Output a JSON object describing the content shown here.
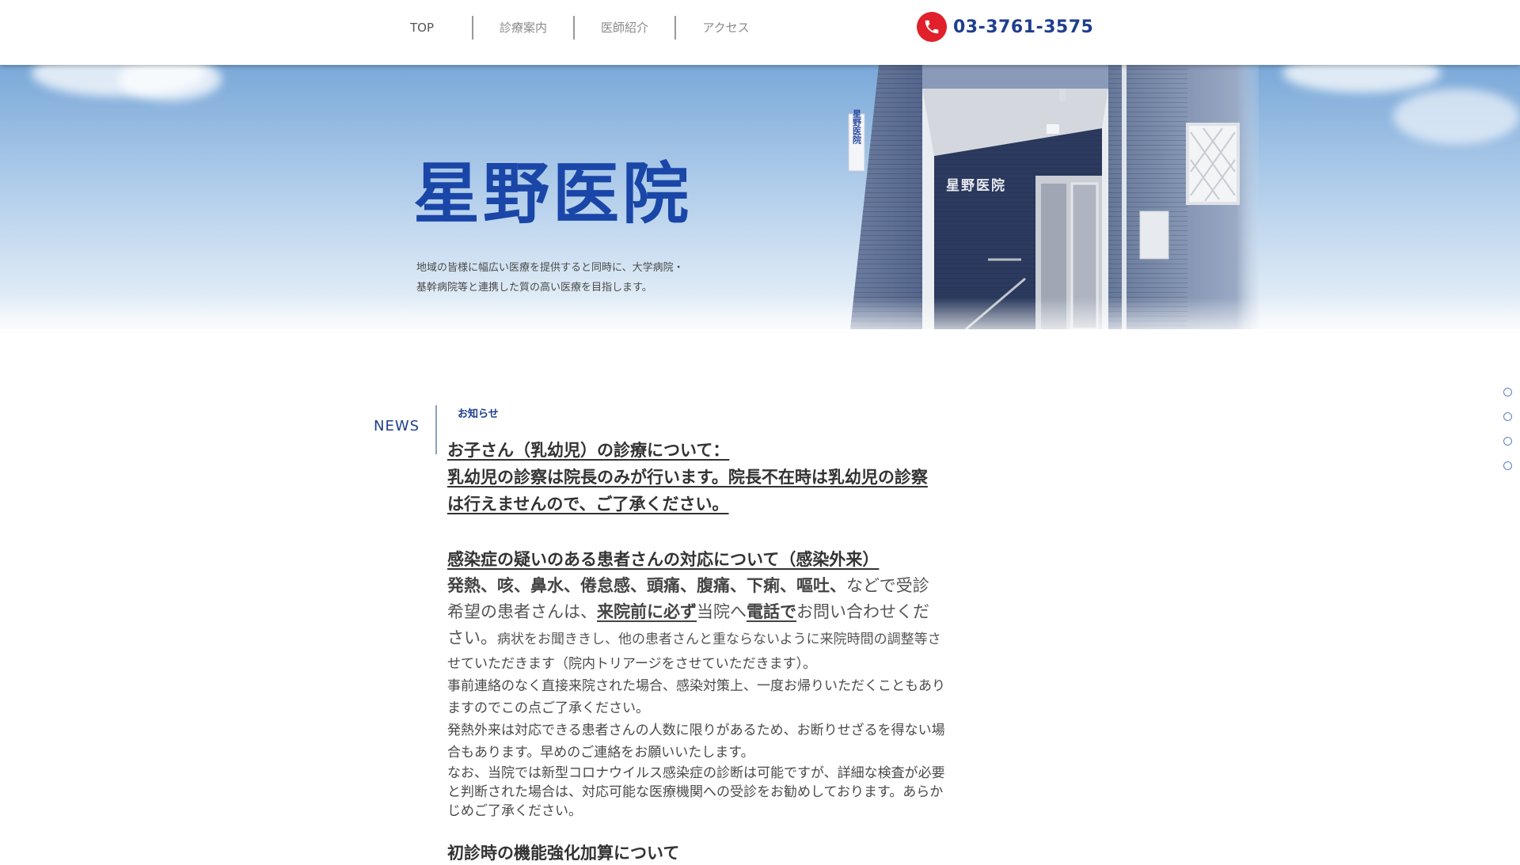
{
  "header": {
    "nav": [
      "TOP",
      "診療案内",
      "医師紹介",
      "アクセス"
    ],
    "phone": "03-3761-3575",
    "phone_icon": "phone-icon"
  },
  "hero": {
    "clinic_name": "星野医院",
    "tagline_line1": "地域の皆様に幅広い医療を提供すると同時に、大学病院・",
    "tagline_line2": "基幹病院等と連携した質の高い医療を目指します。",
    "sign_text": "星野医院",
    "sign_vertical": "星野医院"
  },
  "news": {
    "label": "NEWS",
    "category": "お知らせ",
    "block1": {
      "line1": "お子さん（乳幼児）の診療について：",
      "line2": "乳幼児の診察は院長のみが行います。院長不在時は乳幼児の診察",
      "line3": "は行えませんので、ご了承ください。"
    },
    "block2": {
      "title": "感染症の疑いのある患者さんの対応について（感染外来）",
      "symptoms": "発熱、咳、鼻水、倦怠感、頭痛、腹痛、下痢、嘔吐、",
      "text1": "などで受診",
      "text2": "希望の患者さんは、",
      "emph1": "来院前に必ず",
      "text3": "当院へ",
      "emph2": "電話で",
      "text4": "お問い合わせくだ",
      "text5": "さい。",
      "text6": "病状をお聞ききし、他の患者さんと重ならないように来院時間の調整等さ",
      "para1": "せていただきます（院内トリアージをさせていただきます）。",
      "para2": "事前連絡のなく直接来院された場合、感染対策上、一度お帰りいただくこともあり",
      "para3": "ますのでこの点ご了承ください。",
      "para4": "発熱外来は対応できる患者さんの人数に限りがあるため、お断りせざるを得ない場",
      "para5": "合もあります。早めのご連絡をお願いいたします。",
      "para6": "なお、当院では新型コロナウイルス感染症の診断は可能ですが、詳細な検査が必要",
      "para7": "と判断された場合は、対応可能な医療機関への受診をお勧めしております。あらか",
      "para8": "じめご了承ください。"
    },
    "block3_title": "初診時の機能強化加算について"
  },
  "colors": {
    "brand_blue": "#1a46a8",
    "nav_text": "#8a8a8a",
    "phone_red": "#e0202a",
    "news_blue": "#1f3e8e"
  }
}
